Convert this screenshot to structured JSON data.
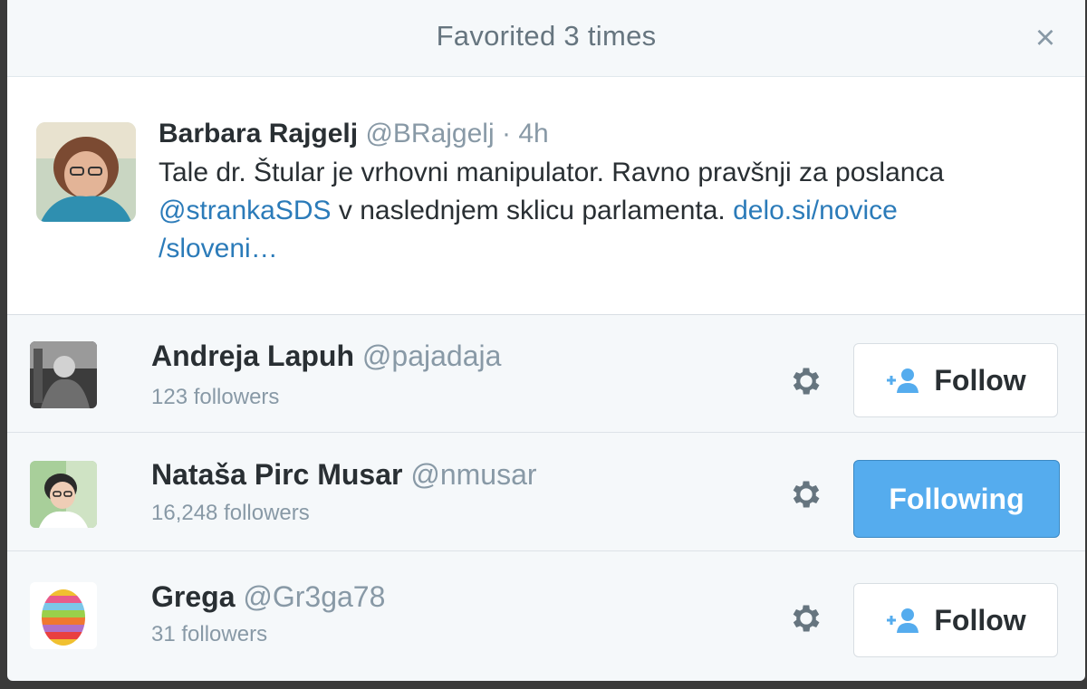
{
  "dialog": {
    "title": "Favorited 3 times",
    "close_label": "×"
  },
  "tweet": {
    "name": "Barbara Rajgelj",
    "handle": "@BRajgelj",
    "separator": "·",
    "time": "4h",
    "text_1": "Tale dr. Štular je vrhovni manipulator. Ravno pravšnji za poslanca",
    "mention": "@strankaSDS",
    "text_2": " v naslednjem sklicu parlamenta. ",
    "link_1": "delo.si/novice",
    "link_2": "/sloveni…"
  },
  "users": [
    {
      "name": "Andreja Lapuh",
      "handle": "@pajadaja",
      "followers": "123 followers",
      "button": "Follow",
      "avatar_icon": "user-photo-icon"
    },
    {
      "name": "Nataša Pirc Musar",
      "handle": "@nmusar",
      "followers": "16,248 followers",
      "button": "Following",
      "avatar_icon": "user-photo-icon"
    },
    {
      "name": "Grega",
      "handle": "@Gr3ga78",
      "followers": "31 followers",
      "button": "Follow",
      "avatar_icon": "easter-egg-icon"
    }
  ],
  "colors": {
    "link": "#2b7bb9",
    "following_bg": "#55acee",
    "muted": "#8899a6"
  }
}
